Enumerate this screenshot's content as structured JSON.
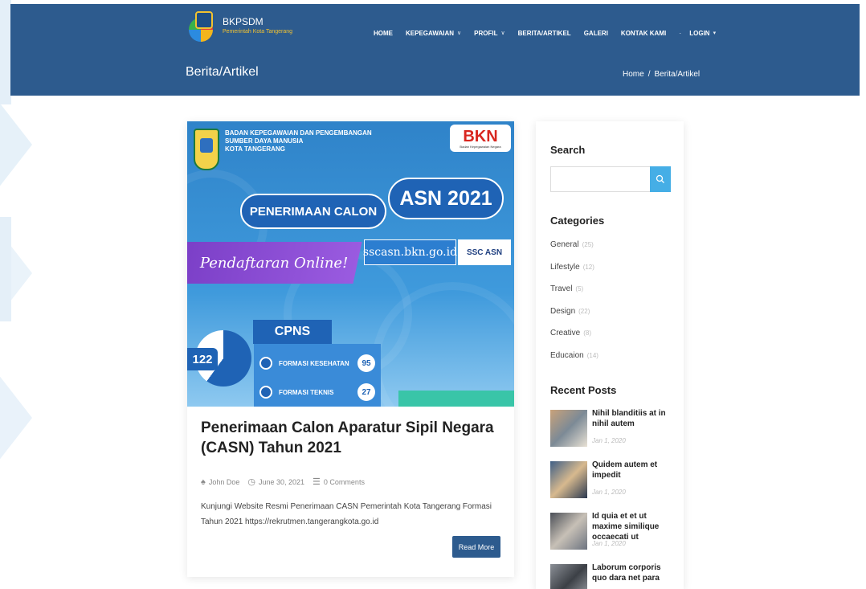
{
  "site": {
    "name": "BKPSDM",
    "tagline": "Pemerintah Kota Tangerang"
  },
  "nav": [
    {
      "label": "HOME",
      "dropdown": false
    },
    {
      "label": "KEPEGAWAIAN",
      "dropdown": true
    },
    {
      "label": "PROFIL",
      "dropdown": true
    },
    {
      "label": "BERITA/ARTIKEL",
      "dropdown": false
    },
    {
      "label": "GALERI",
      "dropdown": false
    },
    {
      "label": "KONTAK KAMI",
      "dropdown": false
    }
  ],
  "nav_login": "LOGIN",
  "page_heading": "Berita/Artikel",
  "breadcrumb": {
    "home": "Home",
    "sep": "/",
    "current": "Berita/Artikel"
  },
  "banner": {
    "org_line1": "BADAN KEPEGAWAIAN DAN PENGEMBANGAN",
    "org_line2": "SUMBER DAYA MANUSIA",
    "org_line3": "KOTA TANGERANG",
    "bkn": "BKN",
    "bkn_sub": "Badan Kepegawaian Negara",
    "penerimaan": "PENERIMAAN CALON",
    "asn": "ASN 2021",
    "daftar": "Pendaftaran Online!",
    "url": "sscasn.bkn.go.id",
    "ssc": "SSC ASN",
    "cpns": "CPNS",
    "total": "122",
    "rows": [
      {
        "label": "FORMASI KESEHATAN",
        "value": "95"
      },
      {
        "label": "FORMASI TEKNIS",
        "value": "27"
      }
    ]
  },
  "post": {
    "title": "Penerimaan Calon Aparatur Sipil Negara (CASN) Tahun 2021",
    "author": "John Doe",
    "date": "June 30, 2021",
    "comments": "0 Comments",
    "excerpt": "Kunjungi Website Resmi Penerimaan CASN Pemerintah Kota Tangerang Formasi Tahun 2021 https://rekrutmen.tangerangkota.go.id",
    "read_more": "Read More"
  },
  "sidebar": {
    "search_title": "Search",
    "search_value": "",
    "categories_title": "Categories",
    "categories": [
      {
        "name": "General",
        "count": "(25)"
      },
      {
        "name": "Lifestyle",
        "count": "(12)"
      },
      {
        "name": "Travel",
        "count": "(5)"
      },
      {
        "name": "Design",
        "count": "(22)"
      },
      {
        "name": "Creative",
        "count": "(8)"
      },
      {
        "name": "Educaion",
        "count": "(14)"
      }
    ],
    "recent_title": "Recent Posts",
    "recent": [
      {
        "title": "Nihil blanditiis at in nihil autem",
        "date": "Jan 1, 2020"
      },
      {
        "title": "Quidem autem et impedit",
        "date": "Jan 1, 2020"
      },
      {
        "title": "Id quia et et ut maxime similique occaecati ut",
        "date": "Jan 1, 2020"
      },
      {
        "title": "Laborum corporis quo dara net para",
        "date": ""
      }
    ]
  },
  "colors": {
    "header": "#2d5b8e",
    "accent": "#45aee6",
    "button": "#2d5b8e"
  }
}
